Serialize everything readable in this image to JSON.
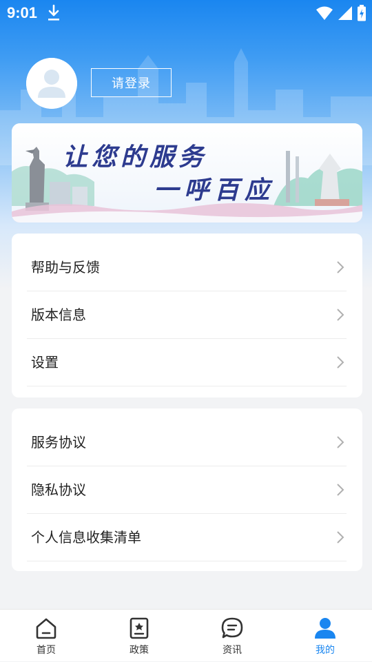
{
  "status_bar": {
    "time": "9:01"
  },
  "profile": {
    "login_label": "请登录"
  },
  "banner": {
    "slogan_line1": "让您的服务",
    "slogan_line2": "一呼百应"
  },
  "menu_group_1": [
    {
      "label": "帮助与反馈"
    },
    {
      "label": "版本信息"
    },
    {
      "label": "设置"
    }
  ],
  "menu_group_2": [
    {
      "label": "服务协议"
    },
    {
      "label": "隐私协议"
    },
    {
      "label": "个人信息收集清单"
    }
  ],
  "bottom_nav": [
    {
      "label": "首页",
      "icon": "home-icon",
      "active": false
    },
    {
      "label": "政策",
      "icon": "policy-icon",
      "active": false
    },
    {
      "label": "资讯",
      "icon": "chat-bubble-icon",
      "active": false
    },
    {
      "label": "我的",
      "icon": "person-icon",
      "active": true
    }
  ],
  "colors": {
    "accent": "#1a86f0",
    "banner_text": "#2d3b8f",
    "inactive_icon": "#333333"
  }
}
